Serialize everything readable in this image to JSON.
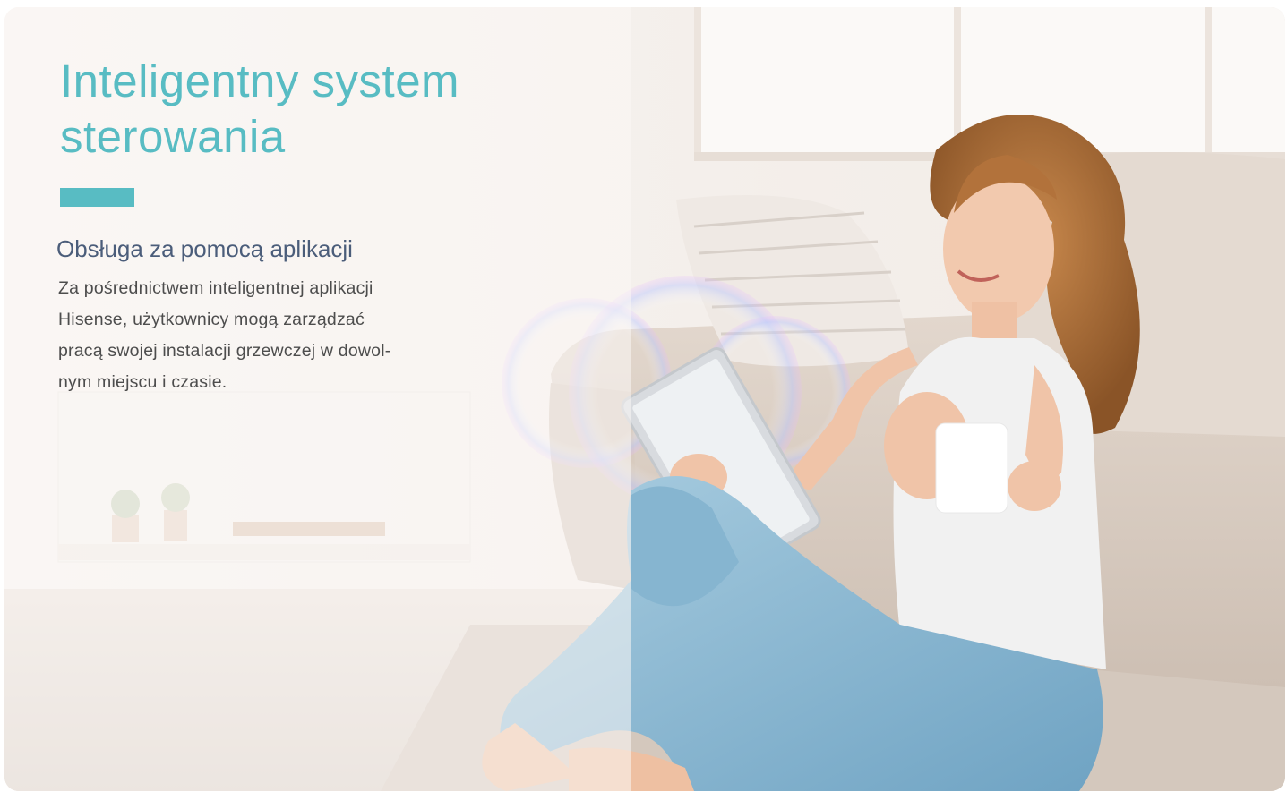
{
  "hero": {
    "title_line1": "Inteligentny system",
    "title_line2": "sterowania",
    "accent_color": "#58bcc3",
    "subtitle": "Obsługa za pomocą aplikacji",
    "body_line1": "Za pośrednictwem inteligentnej aplikacji",
    "body_line2": "Hisense, użytkownicy mogą zarządzać",
    "body_line3": "pracą swojej instalacji grzewczej w dowol-",
    "body_line4": "nym miejscu i czasie."
  },
  "image": {
    "description_icon": "woman-with-tablet-photo"
  }
}
